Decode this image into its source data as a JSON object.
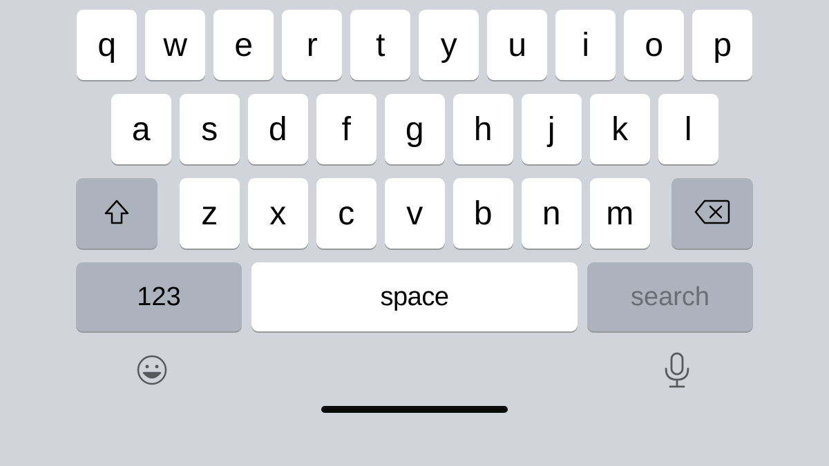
{
  "keyboard": {
    "row1": [
      "q",
      "w",
      "e",
      "r",
      "t",
      "y",
      "u",
      "i",
      "o",
      "p"
    ],
    "row2": [
      "a",
      "s",
      "d",
      "f",
      "g",
      "h",
      "j",
      "k",
      "l"
    ],
    "row3": [
      "z",
      "x",
      "c",
      "v",
      "b",
      "n",
      "m"
    ],
    "numbers_label": "123",
    "space_label": "space",
    "search_label": "search"
  },
  "icons": {
    "shift": "shift-icon",
    "backspace": "backspace-icon",
    "emoji": "emoji-icon",
    "mic": "mic-icon"
  }
}
